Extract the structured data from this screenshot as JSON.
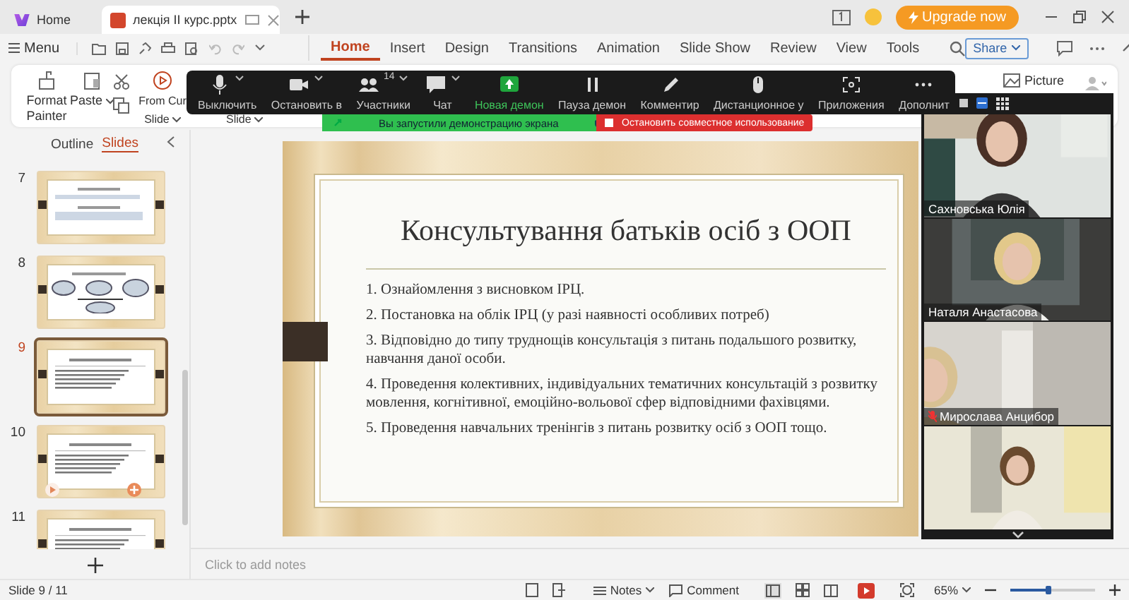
{
  "browser_tabs": [
    {
      "label": "Home",
      "selected": false
    },
    {
      "label": "лекція ІІ курс.pptx",
      "selected": true
    }
  ],
  "upgrade_button": "Upgrade now",
  "menu_button": "Menu",
  "ribbon_tabs": [
    {
      "label": "Home",
      "selected": true
    },
    {
      "label": "Insert",
      "selected": false
    },
    {
      "label": "Design",
      "selected": false
    },
    {
      "label": "Transitions",
      "selected": false
    },
    {
      "label": "Animation",
      "selected": false
    },
    {
      "label": "Slide Show",
      "selected": false
    },
    {
      "label": "Review",
      "selected": false
    },
    {
      "label": "View",
      "selected": false
    },
    {
      "label": "Tools",
      "selected": false
    }
  ],
  "share_button": "Share",
  "ribbon": {
    "format_painter": "Format Painter",
    "paste": "Paste",
    "from_current": "From Cur",
    "from_current_2": "Slide",
    "slide_menu": "Slide",
    "picture": "Picture"
  },
  "meeting_toolbar": {
    "participants_count": "14",
    "buttons": [
      {
        "label": "Выключить",
        "kind": "mic"
      },
      {
        "label": "Остановить в",
        "kind": "camera"
      },
      {
        "label": "Участники",
        "kind": "participants"
      },
      {
        "label": "Чат",
        "kind": "chat"
      },
      {
        "label": "Новая демон",
        "kind": "share"
      },
      {
        "label": "Пауза демон",
        "kind": "pause"
      },
      {
        "label": "Комментир",
        "kind": "annotate"
      },
      {
        "label": "Дистанционное у",
        "kind": "remote"
      },
      {
        "label": "Приложения",
        "kind": "apps"
      },
      {
        "label": "Дополнит",
        "kind": "more"
      }
    ]
  },
  "share_banner": {
    "status": "Вы запустили демонстрацию экрана",
    "stop_button": "Остановить совместное использование"
  },
  "slides_panel": {
    "tabs": [
      {
        "label": "Outline",
        "selected": false
      },
      {
        "label": "Slides",
        "selected": true
      }
    ],
    "slides": [
      {
        "number": "7",
        "selected": false
      },
      {
        "number": "8",
        "selected": false
      },
      {
        "number": "9",
        "selected": true
      },
      {
        "number": "10",
        "selected": false
      },
      {
        "number": "11",
        "selected": false
      }
    ]
  },
  "slide": {
    "title": "Консультування батьків осіб з ООП",
    "items": [
      "1. Ознайомлення з висновком ІРЦ.",
      "2. Постановка на облік ІРЦ (у разі наявності особливих потреб)",
      "3. Відповідно до типу труднощів консультація з питань подальшого розвитку, навчання даної особи.",
      "4. Проведення колективних, індивідуальних тематичних консультацій з розвитку мовлення, когнітивної, емоційно-вольової сфер відповідними фахівцями.",
      "5. Проведення навчальних тренінгів з питань розвитку осіб з ООП тощо."
    ]
  },
  "notes_placeholder": "Click to add notes",
  "participants": [
    {
      "name": "Сахновська Юлія",
      "muted": false
    },
    {
      "name": "Наталя Анастасова",
      "muted": false
    },
    {
      "name": "Мирослава Анцибор",
      "muted": true
    },
    {
      "muted": false
    }
  ],
  "status_bar": {
    "slide_counter": "Slide 9 / 11",
    "notes_button": "Notes",
    "comment_button": "Comment",
    "zoom_value": "65%",
    "zoom_slider": {
      "level": 0.45
    }
  }
}
